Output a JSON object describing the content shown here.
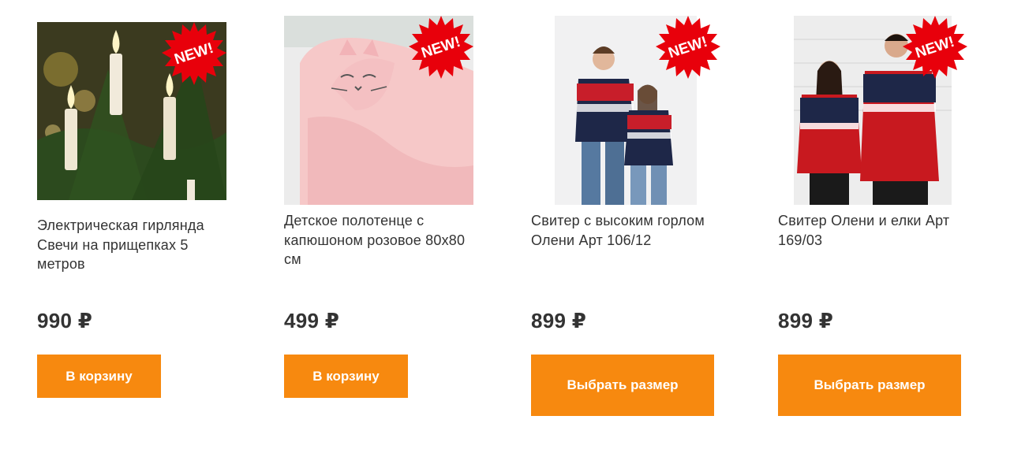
{
  "colors": {
    "accent": "#f7890f",
    "badge": "#e8000b",
    "text": "#333333"
  },
  "badge_text": "NEW!",
  "products": [
    {
      "title": "Электрическая гирлянда Свечи на прищепках 5 метров",
      "price": "990 ₽",
      "button": "В корзину",
      "image": "candle-garland-photo"
    },
    {
      "title": "Детское полотенце с капюшоном розовое 80х80 см",
      "price": "499 ₽",
      "button": "В корзину",
      "image": "pink-towel-photo"
    },
    {
      "title": "Свитер с высоким горлом Олени Арт 106/12",
      "price": "899 ₽",
      "button": "Выбрать размер",
      "image": "couple-sweater-photo"
    },
    {
      "title": "Свитер Олени и елки Арт 169/03",
      "price": "899 ₽",
      "button": "Выбрать размер",
      "image": "couple-red-sweater-photo"
    }
  ]
}
